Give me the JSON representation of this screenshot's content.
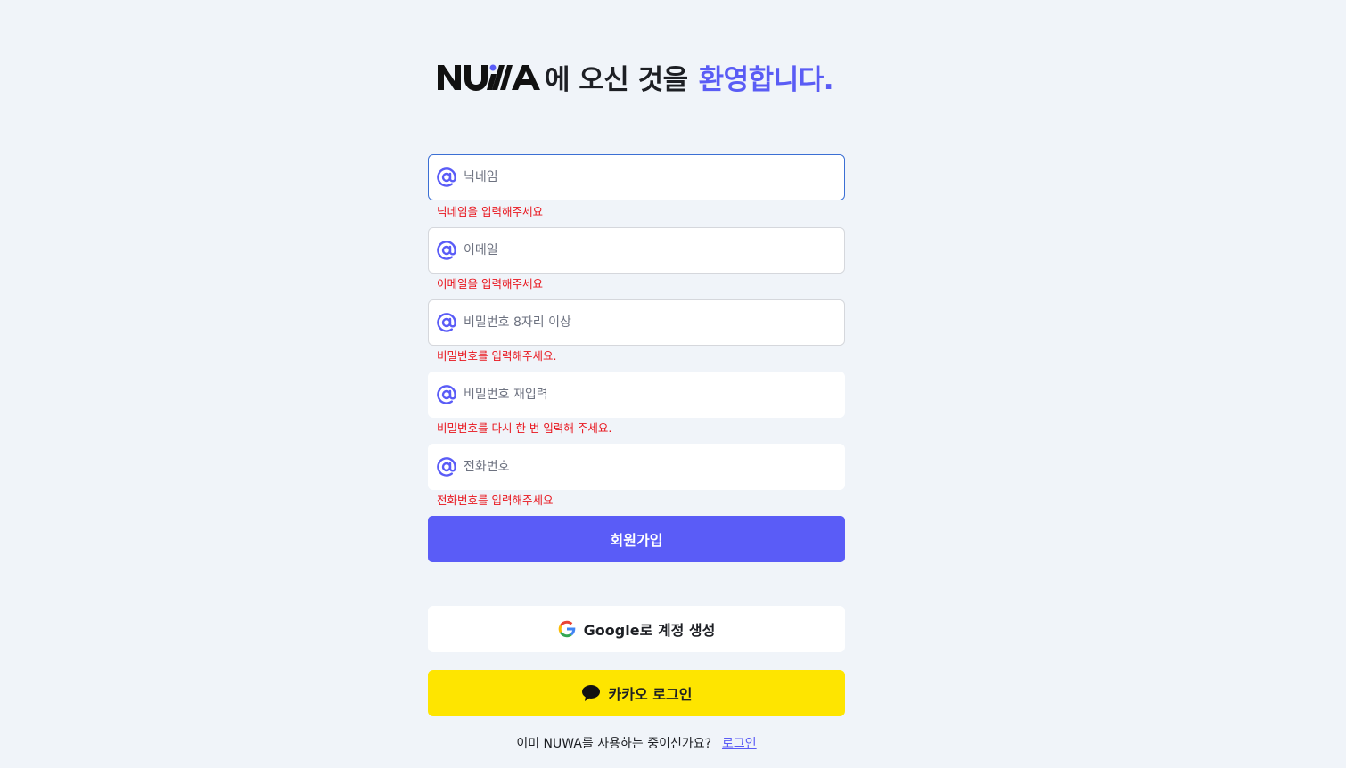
{
  "header": {
    "brand": "NUWA",
    "title_prefix": "에 오신 것을",
    "title_accent": "환영합니다."
  },
  "form": {
    "fields": [
      {
        "placeholder": "닉네임",
        "value": "",
        "error": "닉네임을 입력해주세요",
        "icon": "at-sign-icon"
      },
      {
        "placeholder": "이메일",
        "value": "",
        "error": "이메일을 입력해주세요",
        "icon": "at-sign-icon"
      },
      {
        "placeholder": "비밀번호 8자리 이상",
        "value": "",
        "error": "비밀번호를 입력해주세요.",
        "icon": "at-sign-icon"
      },
      {
        "placeholder": "비밀번호 재입력",
        "value": "",
        "error": "비밀번호를 다시 한 번 입력해 주세요.",
        "icon": "at-sign-icon"
      },
      {
        "placeholder": "전화번호",
        "value": "",
        "error": "전화번호를 입력해주세요",
        "icon": "at-sign-icon"
      }
    ],
    "submit_label": "회원가입"
  },
  "social": {
    "google_label": "Google로 계정 생성",
    "kakao_label": "카카오 로그인"
  },
  "footer": {
    "text": "이미 NUWA를 사용하는 중이신가요?",
    "login_link": "로그인"
  },
  "colors": {
    "accent": "#5a5cf7",
    "error": "#e8141c",
    "kakao": "#fee500",
    "background": "#f0f4f9"
  }
}
